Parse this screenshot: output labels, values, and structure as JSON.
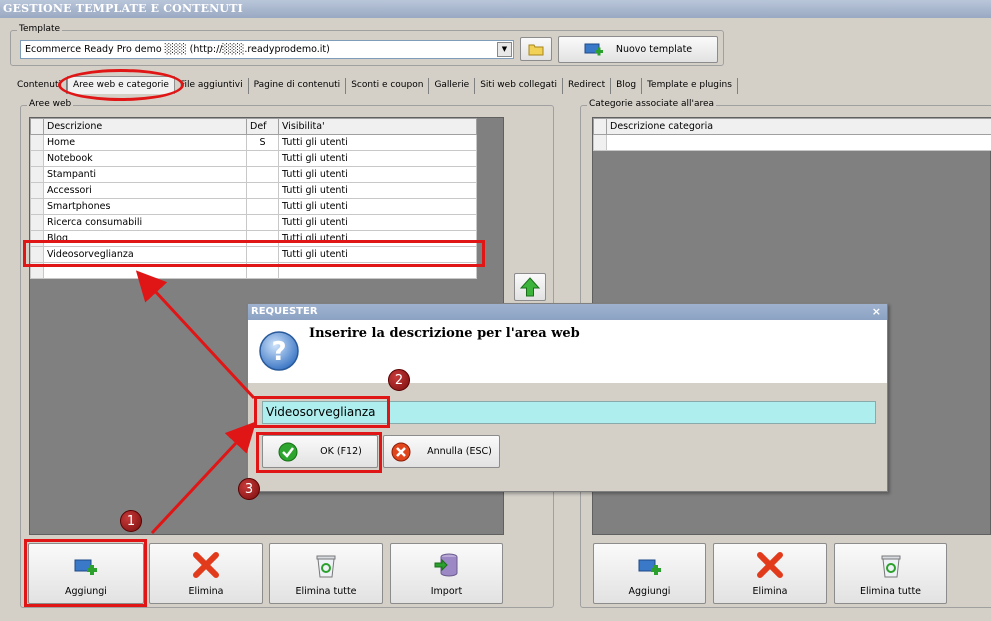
{
  "window": {
    "title": "GESTIONE TEMPLATE E CONTENUTI"
  },
  "template_group": {
    "legend": "Template",
    "selected": "Ecommerce Ready Pro demo ░░░ (http://░░░.readyprodemo.it)",
    "nuovo_label": "Nuovo template"
  },
  "tabs": [
    "Contenuti",
    "Aree web e categorie",
    "File aggiuntivi",
    "Pagine di contenuti",
    "Sconti e coupon",
    "Gallerie",
    "Siti web collegati",
    "Redirect",
    "Blog",
    "Template e plugins"
  ],
  "aree_web": {
    "legend": "Aree web",
    "columns": {
      "descrizione": "Descrizione",
      "def": "Def",
      "visibilita": "Visibilita'"
    },
    "rows": [
      {
        "descrizione": "Home",
        "def": "S",
        "visibilita": "Tutti gli utenti"
      },
      {
        "descrizione": "Notebook",
        "def": "",
        "visibilita": "Tutti gli utenti"
      },
      {
        "descrizione": "Stampanti",
        "def": "",
        "visibilita": "Tutti gli utenti"
      },
      {
        "descrizione": "Accessori",
        "def": "",
        "visibilita": "Tutti gli utenti"
      },
      {
        "descrizione": "Smartphones",
        "def": "",
        "visibilita": "Tutti gli utenti"
      },
      {
        "descrizione": "Ricerca consumabili",
        "def": "",
        "visibilita": "Tutti gli utenti"
      },
      {
        "descrizione": "Blog",
        "def": "",
        "visibilita": "Tutti gli utenti"
      },
      {
        "descrizione": "Videosorveglianza",
        "def": "",
        "visibilita": "Tutti gli utenti"
      }
    ],
    "buttons": {
      "aggiungi": "Aggiungi",
      "elimina": "Elimina",
      "elimina_tutte": "Elimina tutte",
      "import": "Import"
    }
  },
  "categorie": {
    "legend": "Categorie associate all'area",
    "column": "Descrizione categoria",
    "buttons": {
      "aggiungi": "Aggiungi",
      "elimina": "Elimina",
      "elimina_tutte": "Elimina tutte"
    }
  },
  "dialog": {
    "title": "REQUESTER",
    "close": "×",
    "message": "Inserire la descrizione per l'area web",
    "input_value": "Videosorveglianza",
    "ok_label": "OK (F12)",
    "annulla_label": "Annulla (ESC)"
  },
  "annotations": {
    "badge1": "1",
    "badge2": "2",
    "badge3": "3"
  },
  "colors": {
    "highlight": "#e01515",
    "input_bg": "#aeeeee",
    "grid_bg": "#808080"
  }
}
